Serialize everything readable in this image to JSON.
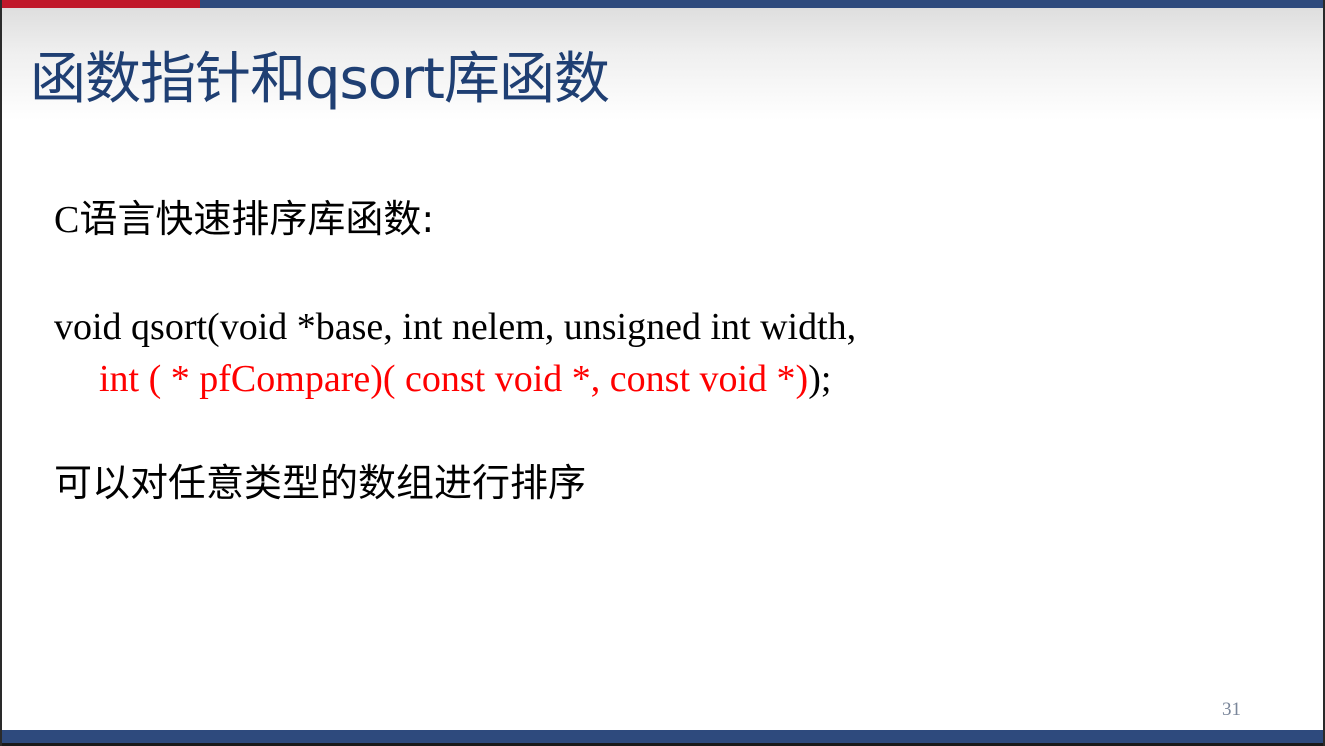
{
  "slide": {
    "title": "函数指针和qsort库函数",
    "heading_latin": "C",
    "heading_cn": "语言快速排序库函数:",
    "code_line1": "void qsort(void *base, int nelem, unsigned int width,",
    "code_line2_red": "int ( * pfCompare)( const void *, const void *)",
    "code_line2_end": ");",
    "description": "可以对任意类型的数组进行排序",
    "page_number": "31"
  },
  "colors": {
    "title": "#1f3f73",
    "accent_red": "#c0182a",
    "bar_blue": "#2e4a7d",
    "code_highlight": "#ff0000"
  }
}
